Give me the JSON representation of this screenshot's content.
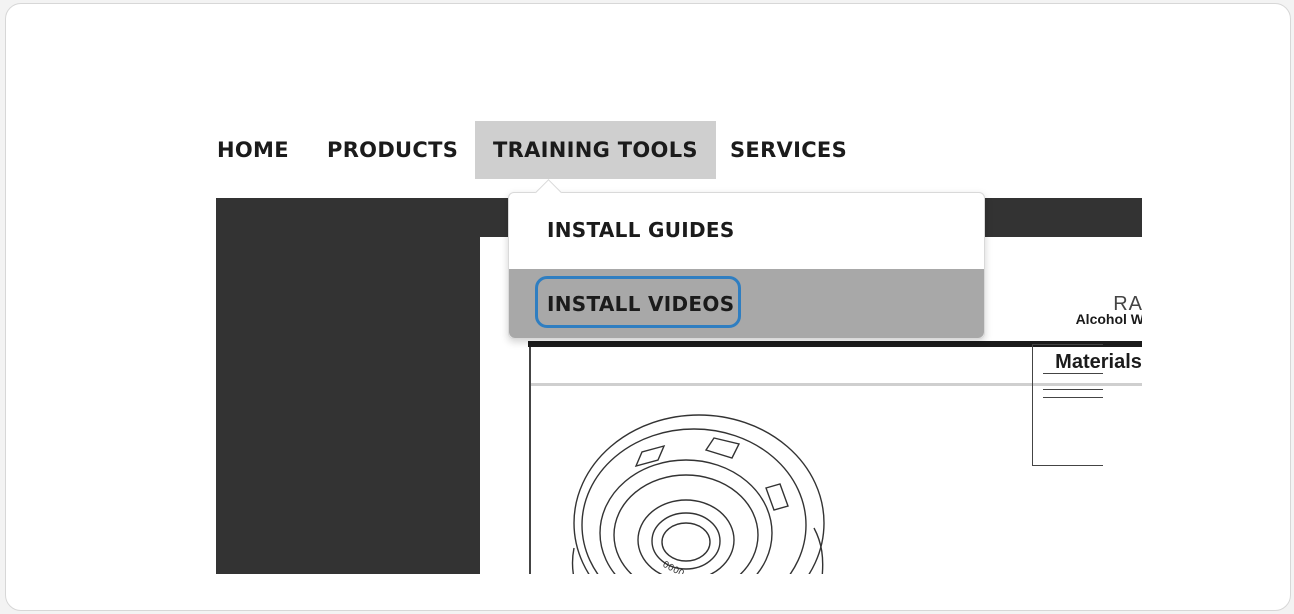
{
  "nav": {
    "items": [
      {
        "label": "HOME"
      },
      {
        "label": "PRODUCTS"
      },
      {
        "label": "TRAINING TOOLS"
      },
      {
        "label": "SERVICES"
      }
    ]
  },
  "dropdown": {
    "items": [
      {
        "label": "INSTALL GUIDES"
      },
      {
        "label": "INSTALL VIDEOS"
      }
    ]
  },
  "document": {
    "top_right_text": "RA",
    "materials_heading": "Materials i",
    "alcohol_label": "Alcohol W"
  },
  "colors": {
    "active_nav_bg": "#cfcfcf",
    "dark_panel": "#333333",
    "hover_item_bg": "#a8a8a8",
    "focus_ring": "#2f7ec1"
  }
}
